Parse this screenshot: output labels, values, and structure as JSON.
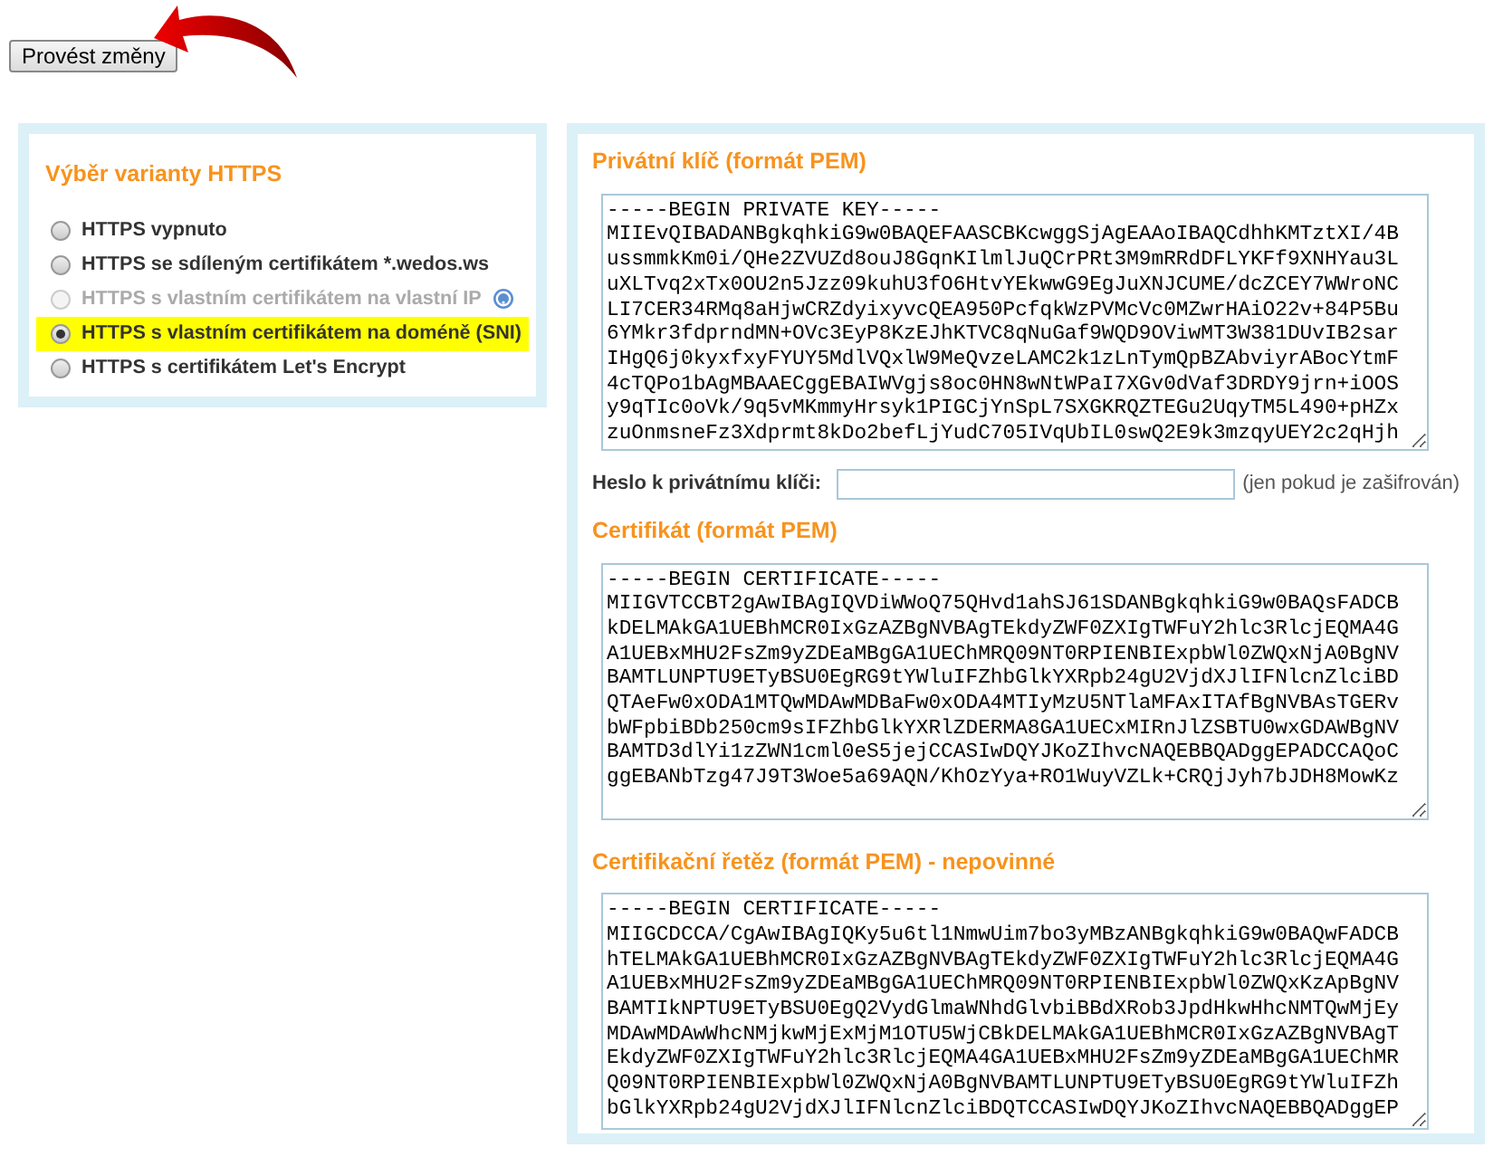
{
  "submit_button": {
    "label": "Provést změny"
  },
  "https_variant": {
    "title": "Výběr varianty HTTPS",
    "options": [
      {
        "label": "HTTPS vypnuto",
        "selected": false,
        "disabled": false,
        "help_icon": false
      },
      {
        "label": "HTTPS se sdíleným certifikátem *.wedos.ws",
        "selected": false,
        "disabled": false,
        "help_icon": false
      },
      {
        "label": "HTTPS s vlastním certifikátem na vlastní IP",
        "selected": false,
        "disabled": true,
        "help_icon": true
      },
      {
        "label": "HTTPS s vlastním certifikátem na doméně (SNI)",
        "selected": true,
        "disabled": false,
        "help_icon": false
      },
      {
        "label": "HTTPS s certifikátem Let's Encrypt",
        "selected": false,
        "disabled": false,
        "help_icon": false
      }
    ]
  },
  "private_key": {
    "title": "Privátní klíč (formát PEM)",
    "value": "-----BEGIN PRIVATE KEY-----\nMIIEvQIBADANBgkqhkiG9w0BAQEFAASCBKcwggSjAgEAAoIBAQCdhhKMTztXI/4B\nussmmkKm0i/QHe2ZVUZd8ouJ8GqnKIlmlJuQCrPRt3M9mRRdDFLYKFf9XNHYau3L\nuXLTvq2xTx0OU2n5Jzz09kuhU3fO6HtvYEkwwG9EgJuXNJCUME/dcZCEY7WWroNC\nLI7CER34RMq8aHjwCRZdyixyvcQEA950PcfqkWzPVMcVc0MZwrHAiO22v+84P5Bu\n6YMkr3fdprndMN+OVc3EyP8KzEJhKTVC8qNuGaf9WQD9OViwMT3W381DUvIB2sar\nIHgQ6j0kyxfxyFYUY5MdlVQxlW9MeQvzeLAMC2k1zLnTymQpBZAbviyrABocYtmF\n4cTQPo1bAgMBAAECggEBAIWVgjs8oc0HN8wNtWPaI7XGv0dVaf3DRDY9jrn+iOOS\ny9qTIc0oVk/9q5vMKmmyHrsyk1PIGCjYnSpL7SXGKRQZTEGu2UqyTM5L490+pHZx\nzuOnmsneFz3Xdprmt8kDo2befLjYudC705IVqUbIL0swQ2E9k3mzqyUEY2c2qHjh"
  },
  "password_field": {
    "label": "Heslo k privátnímu klíči:",
    "note": "(jen pokud je zašifrován)"
  },
  "certificate": {
    "title": "Certifikát (formát PEM)",
    "value": "-----BEGIN CERTIFICATE-----\nMIIGVTCCBT2gAwIBAgIQVDiWWoQ75QHvd1ahSJ61SDANBgkqhkiG9w0BAQsFADCB\nkDELMAkGA1UEBhMCR0IxGzAZBgNVBAgTEkdyZWF0ZXIgTWFuY2hlc3RlcjEQMA4G\nA1UEBxMHU2FsZm9yZDEaMBgGA1UEChMRQ09NT0RPIENBIExpbWl0ZWQxNjA0BgNV\nBAMTLUNPTU9ETyBSU0EgRG9tYWluIFZhbGlkYXRpb24gU2VjdXJlIFNlcnZlciBD\nQTAeFw0xODA1MTQwMDAwMDBaFw0xODA4MTIyMzU5NTlaMFAxITAfBgNVBAsTGERv\nbWFpbiBDb250cm9sIFZhbGlkYXRlZDERMA8GA1UECxMIRnJlZSBTU0wxGDAWBgNV\nBAMTD3dlYi1zZWN1cml0eS5jejCCASIwDQYJKoZIhvcNAQEBBQADggEPADCCAQoC\nggEBANbTzg47J9T3Woe5a69AQN/KhOzYya+RO1WuyVZLk+CRQjJyh7bJDH8MowKz"
  },
  "certificate_chain": {
    "title": "Certifikační řetěz (formát PEM) - nepovinné",
    "value": "-----BEGIN CERTIFICATE-----\nMIIGCDCCA/CgAwIBAgIQKy5u6tl1NmwUim7bo3yMBzANBgkqhkiG9w0BAQwFADCB\nhTELMAkGA1UEBhMCR0IxGzAZBgNVBAgTEkdyZWF0ZXIgTWFuY2hlc3RlcjEQMA4G\nA1UEBxMHU2FsZm9yZDEaMBgGA1UEChMRQ09NT0RPIENBIExpbWl0ZWQxKzApBgNV\nBAMTIkNPTU9ETyBSU0EgQ2VydGlmaWNhdGlvbiBBdXRob3JpdHkwHhcNMTQwMjEy\nMDAwMDAwWhcNMjkwMjExMjM1OTU5WjCBkDELMAkGA1UEBhMCR0IxGzAZBgNVBAgT\nEkdyZWF0ZXIgTWFuY2hlc3RlcjEQMA4GA1UEBxMHU2FsZm9yZDEaMBgGA1UEChMR\nQ09NT0RPIENBIExpbWl0ZWQxNjA0BgNVBAMTLUNPTU9ETyBSU0EgRG9tYWluIFZh\nbGlkYXRpb24gU2VjdXJlIFNlcnZlciBDQTCCASIwDQYJKoZIhvcNAQEBBQADggEP"
  }
}
